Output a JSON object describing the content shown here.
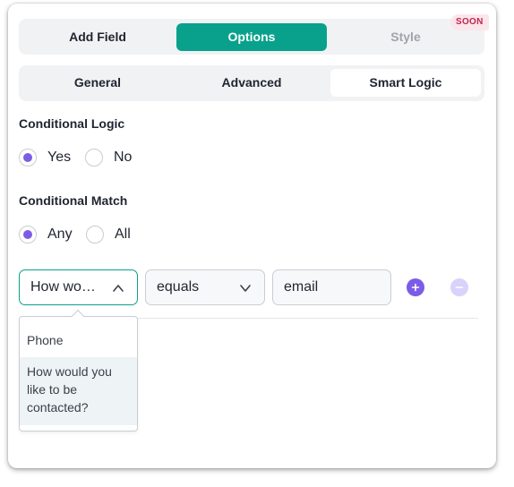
{
  "tabs": {
    "add_field": "Add Field",
    "options": "Options",
    "style": "Style",
    "soon_badge": "SOON"
  },
  "subtabs": {
    "general": "General",
    "advanced": "Advanced",
    "smart_logic": "Smart Logic"
  },
  "conditional_logic": {
    "label": "Conditional Logic",
    "options": [
      "Yes",
      "No"
    ],
    "selected": "Yes"
  },
  "conditional_match": {
    "label": "Conditional Match",
    "options": [
      "Any",
      "All"
    ],
    "selected": "Any"
  },
  "condition": {
    "field_value": "How would you like to be contacted?",
    "operator_value": "equals",
    "value_input": "email"
  },
  "dropdown": {
    "items": [
      "Phone",
      "How would you like to be contacted?"
    ]
  },
  "colors": {
    "accent": "#09a18c",
    "radio": "#7c5ce6",
    "soon": "#c0264f"
  }
}
